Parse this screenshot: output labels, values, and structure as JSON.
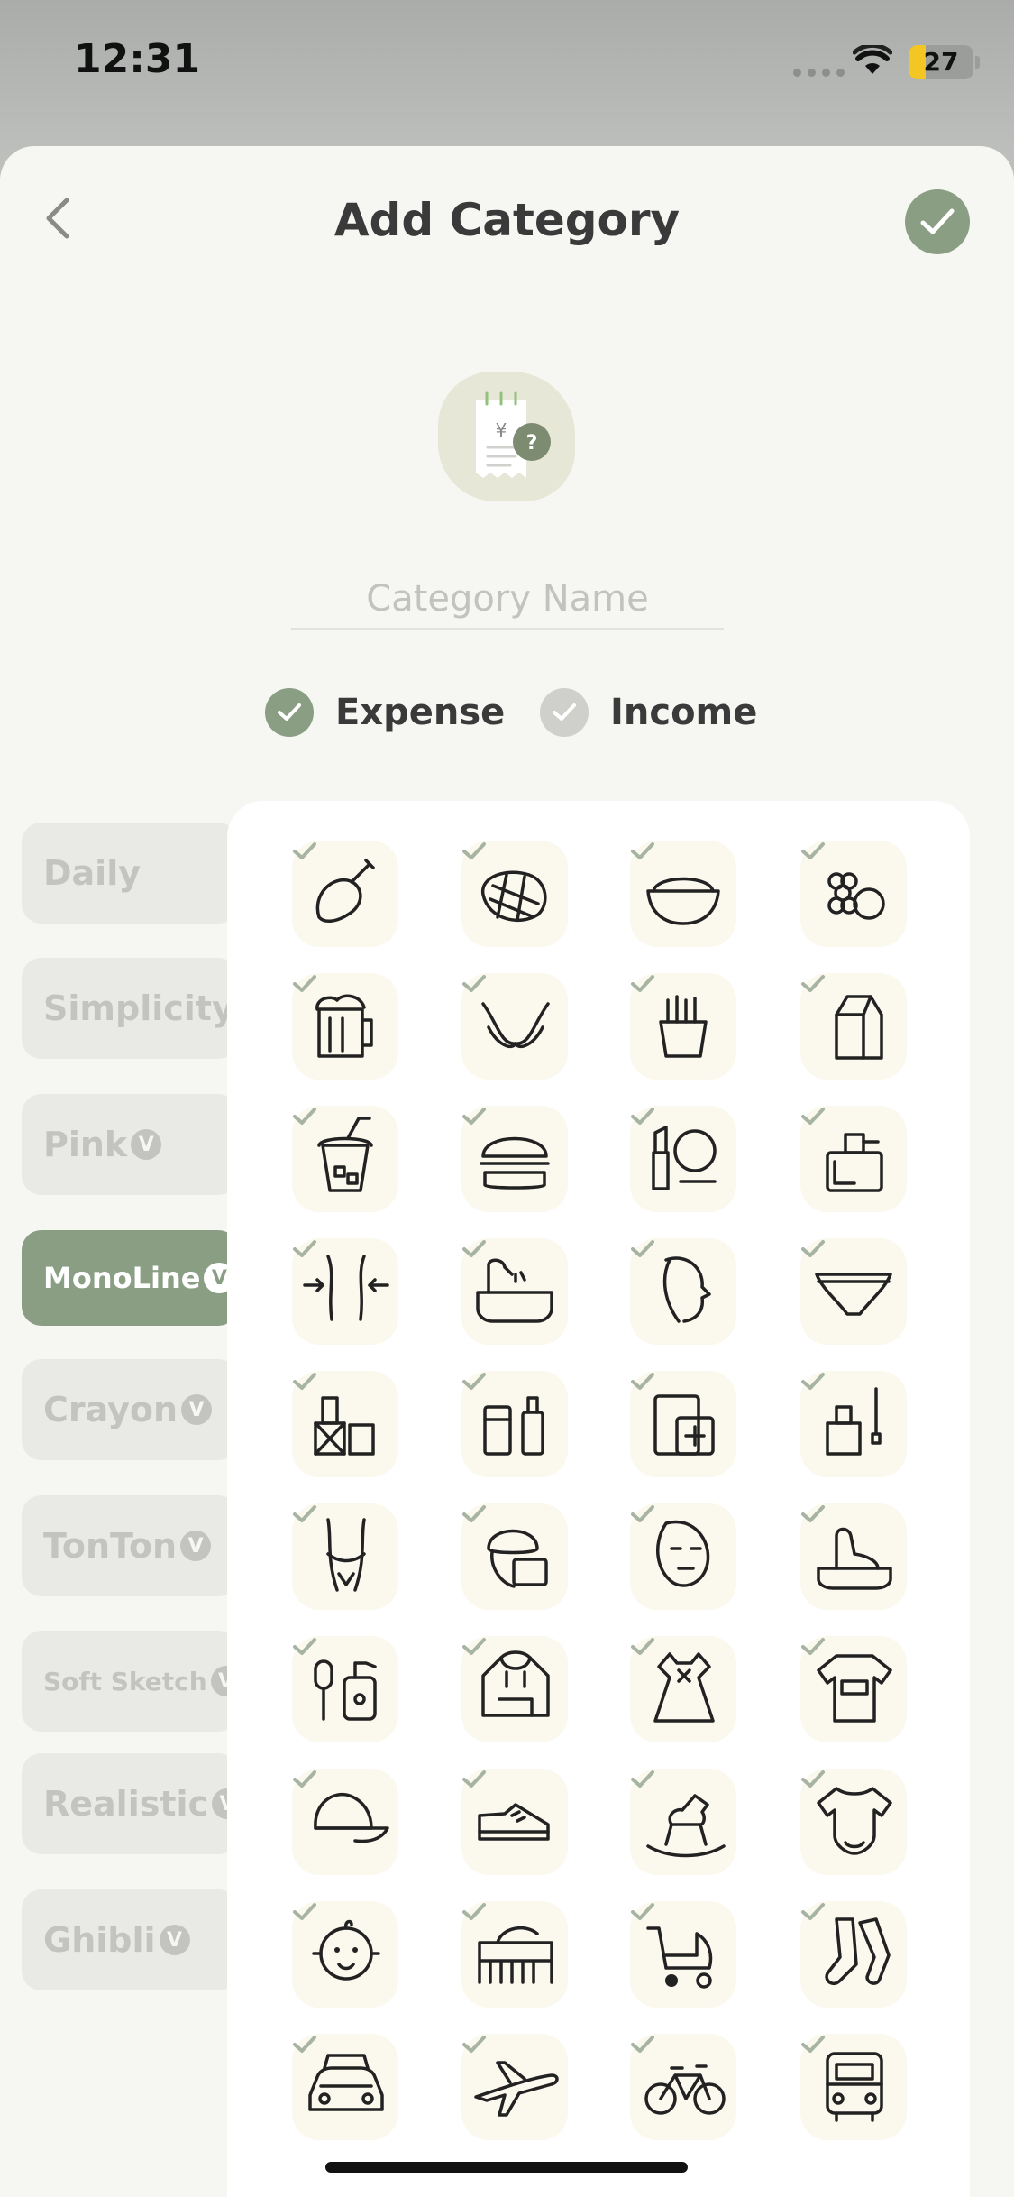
{
  "status_bar": {
    "time": "12:31",
    "battery": "27",
    "battery_fraction": 0.27
  },
  "header": {
    "title": "Add Category",
    "back_icon": "chevron-left-icon",
    "confirm_icon": "check-icon"
  },
  "preview": {
    "icon": "receipt-question-icon"
  },
  "name_field": {
    "placeholder": "Category Name",
    "value": ""
  },
  "type_options": [
    {
      "label": "Expense",
      "selected": true
    },
    {
      "label": "Income",
      "selected": false
    }
  ],
  "style_tabs": [
    {
      "label": "Daily",
      "vip": false,
      "active": false
    },
    {
      "label": "Simplicity",
      "vip": false,
      "active": false
    },
    {
      "label": "Pink",
      "vip": true,
      "active": false
    },
    {
      "label": "MonoLine",
      "vip": true,
      "active": true
    },
    {
      "label": "Crayon",
      "vip": true,
      "active": false
    },
    {
      "label": "TonTon",
      "vip": true,
      "active": false
    },
    {
      "label": "Soft Sketch",
      "vip": true,
      "active": false
    },
    {
      "label": "Realistic",
      "vip": true,
      "active": false
    },
    {
      "label": "Ghibli",
      "vip": true,
      "active": false
    }
  ],
  "vip_badge": "V",
  "icons": [
    "chicken-leg-icon",
    "waffle-icon",
    "rice-bowl-icon",
    "fruits-icon",
    "beer-icon",
    "bra-icon",
    "fries-icon",
    "milk-carton-icon",
    "bubble-tea-icon",
    "burger-icon",
    "lipstick-mirror-icon",
    "perfume-icon",
    "waist-icon",
    "bathtub-icon",
    "face-profile-icon",
    "underwear-icon",
    "cosmetics-icon",
    "skincare-bottles-icon",
    "medical-folder-icon",
    "nail-polish-icon",
    "bikini-body-icon",
    "hair-towel-icon",
    "face-mask-icon",
    "foot-bath-icon",
    "hairbrush-lotion-icon",
    "hoodie-icon",
    "dress-icon",
    "tshirt-icon",
    "cap-icon",
    "sneaker-icon",
    "rocking-horse-icon",
    "baby-onesie-icon",
    "baby-face-icon",
    "crib-icon",
    "stroller-icon",
    "socks-icon",
    "car-icon",
    "airplane-icon",
    "bicycle-icon",
    "bus-icon"
  ],
  "colors": {
    "accent": "#8a9e84",
    "sheet_background": "#f6f7f2",
    "tab_inactive": "#e9eae6",
    "tile_background": "#fbf8ee",
    "title_text": "#3a3a3a"
  }
}
